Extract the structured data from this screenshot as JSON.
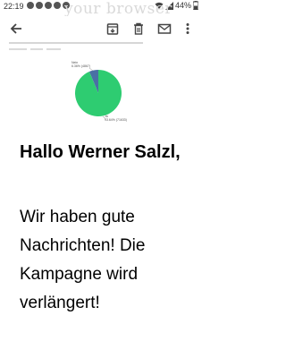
{
  "status_bar": {
    "time": "22:19",
    "battery": "44%",
    "notification_icons": [
      "notification-icon",
      "notification-icon",
      "notification-icon",
      "notification-icon",
      "notification-icon"
    ]
  },
  "watermark": {
    "text": "your browser"
  },
  "toolbar": {
    "icons": [
      "back-arrow-icon",
      "archive-icon",
      "delete-icon",
      "mail-icon",
      "more-vert-icon"
    ]
  },
  "chart_data": {
    "type": "pie",
    "slices": [
      {
        "label": "Nein",
        "value_text": "6.36% (4867)",
        "value": 6.36,
        "color": "#4a6fa5"
      },
      {
        "label": "Ja",
        "value_text": "93.64% (71633)",
        "value": 93.64,
        "color": "#2ecc71"
      }
    ],
    "title": ""
  },
  "email": {
    "greeting": "Hallo Werner Salzl,",
    "body": "Wir haben gute Nachrichten! Die Kampagne wird verlängert!"
  }
}
